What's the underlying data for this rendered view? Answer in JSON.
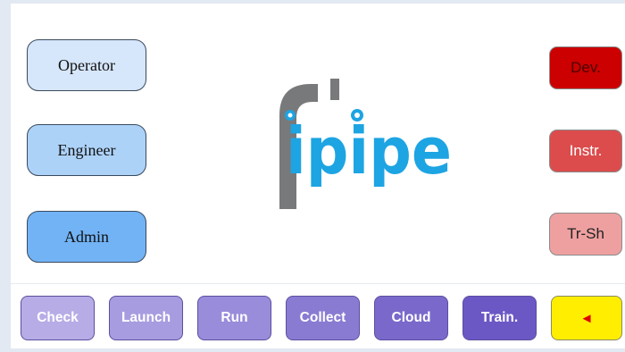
{
  "roles": {
    "operator": "Operator",
    "engineer": "Engineer",
    "admin": "Admin"
  },
  "side_buttons": {
    "dev": "Dev.",
    "instr": "Instr.",
    "trsh": "Tr-Sh"
  },
  "bottom_bar": {
    "check": "Check",
    "launch": "Launch",
    "run": "Run",
    "collect": "Collect",
    "cloud": "Cloud",
    "train": "Train.",
    "back": "◄"
  },
  "logo": {
    "text": "ipipe",
    "name": "ipipe-logo"
  },
  "colors": {
    "logo_gray": "#78797b",
    "logo_blue": "#1da4e3",
    "dev_red": "#cc0000",
    "back_yellow": "#ffee00"
  }
}
